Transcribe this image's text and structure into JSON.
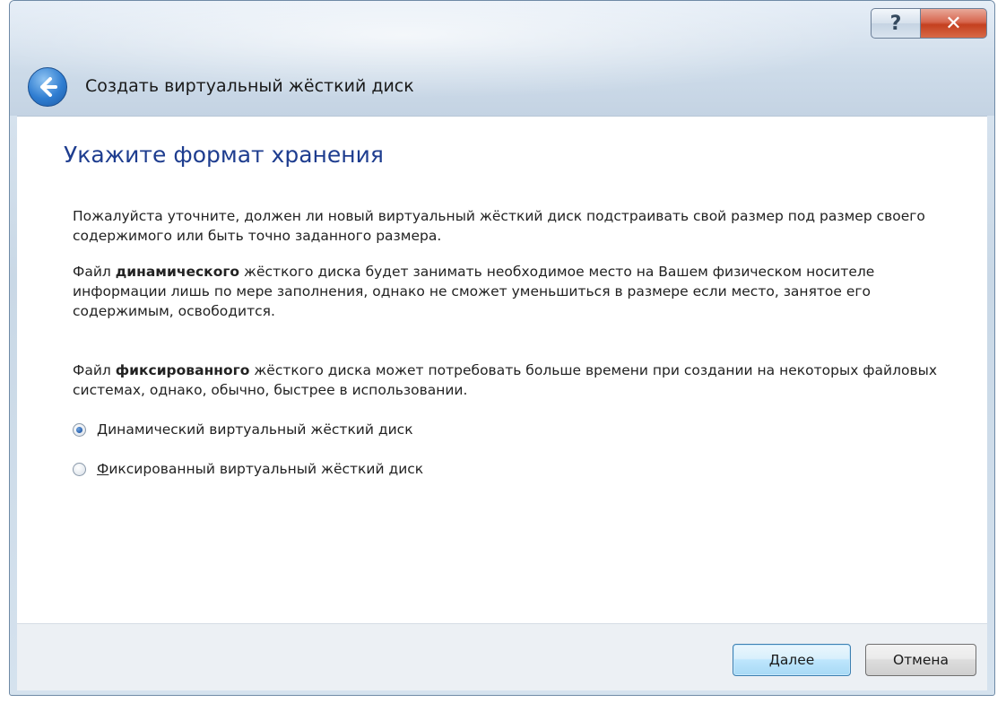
{
  "window": {
    "title": "Создать виртуальный жёсткий диск",
    "help_label": "?",
    "close_label": "✕"
  },
  "content": {
    "heading": "Укажите формат хранения",
    "p1": "Пожалуйста уточните, должен ли новый виртуальный жёсткий диск подстраивать свой размер под размер своего содержимого или быть точно заданного размера.",
    "p2_prefix": "Файл ",
    "p2_bold": "динамического",
    "p2_suffix": " жёсткого диска будет занимать необходимое место на Вашем физическом носителе информации лишь по мере заполнения, однако не сможет уменьшиться в размере если место, занятое его содержимым, освободится.",
    "p3_prefix": "Файл ",
    "p3_bold": "фиксированного",
    "p3_suffix": " жёсткого диска может потребовать больше времени при создании на некоторых файловых системах, однако, обычно, быстрее в использовании.",
    "options": [
      {
        "mnemonic": "Д",
        "rest": "инамический виртуальный жёсткий диск",
        "selected": true
      },
      {
        "mnemonic": "Ф",
        "rest": "иксированный виртуальный жёсткий диск",
        "selected": false
      }
    ]
  },
  "footer": {
    "next_mnemonic": "Д",
    "next_rest": "алее",
    "cancel_label": "Отмена"
  },
  "colors": {
    "heading": "#1e3d8f",
    "accent": "#2f7dd1",
    "close": "#c4401f"
  },
  "icons": {
    "back": "back-arrow-icon",
    "radio_selected": "radio-selected-icon",
    "radio_unselected": "radio-unselected-icon"
  }
}
